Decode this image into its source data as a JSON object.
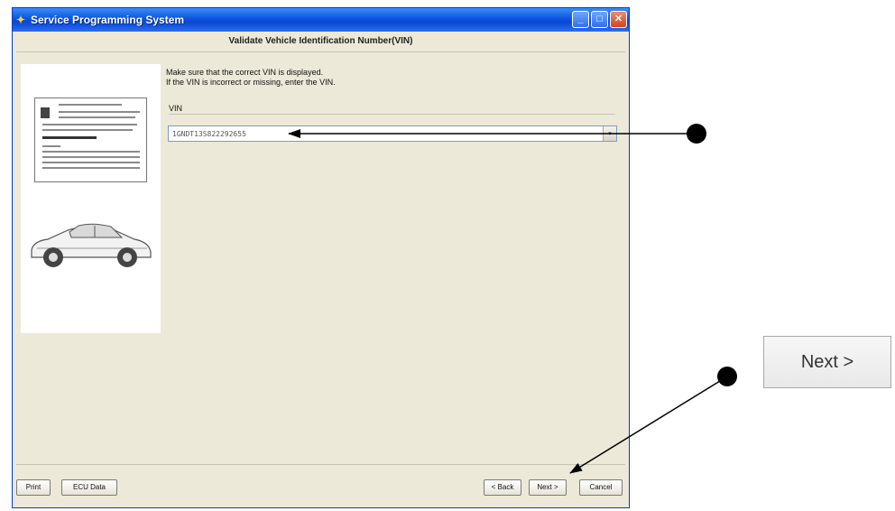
{
  "window": {
    "title": "Service Programming System",
    "icon": "app-logo-icon",
    "controls": {
      "minimize": "_",
      "maximize": "□",
      "close": "✕"
    }
  },
  "header": {
    "title": "Validate Vehicle Identification Number(VIN)"
  },
  "instructions": {
    "line1": "Make sure that the correct VIN is displayed.",
    "line2": "If the VIN is incorrect or missing, enter the VIN."
  },
  "vin": {
    "label": "VIN",
    "value": "1GNDT13S822292655",
    "dropdown_icon": "▾"
  },
  "footer": {
    "print_label": "Print",
    "ecu_data_label": "ECU Data",
    "back_label": "< Back",
    "next_label": "Next >",
    "cancel_label": "Cancel"
  },
  "callout": {
    "next_zoom_label": "Next >"
  },
  "colors": {
    "titlebar": "#0a55e0",
    "window_bg": "#ece9d8",
    "close_button": "#d2451a"
  }
}
